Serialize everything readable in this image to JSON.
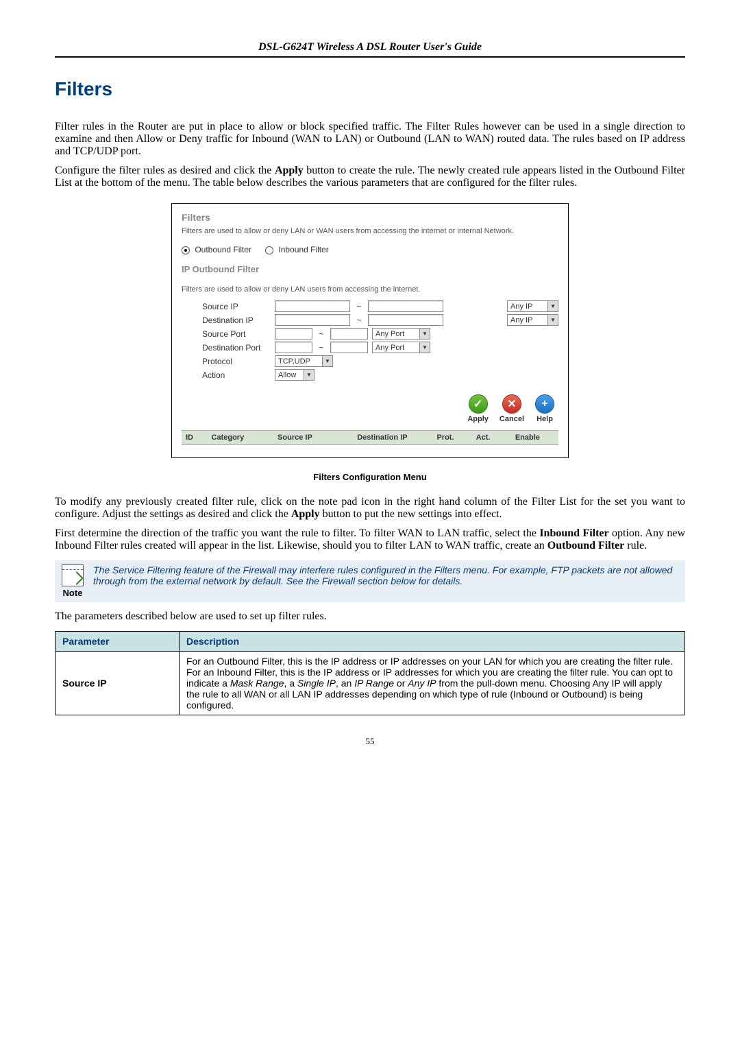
{
  "header": {
    "title": "DSL-G624T Wireless A DSL Router User's Guide"
  },
  "section": {
    "title": "Filters"
  },
  "body": {
    "p1": "Filter rules in the Router are put in place to allow or block specified traffic. The Filter Rules however can be used in a single direction to examine and then Allow or Deny traffic for Inbound (WAN to LAN) or Outbound (LAN to WAN) routed data. The rules based on IP address and TCP/UDP port.",
    "p2a": "Configure the filter rules as desired and click the ",
    "p2_apply": "Apply",
    "p2b": " button to create the rule. The newly created rule appears listed in the Outbound Filter List at the bottom of the menu. The table below describes the various parameters that are configured for the filter rules.",
    "p3a": "To modify any previously created filter rule, click on the note pad icon in the right hand column of the Filter List for the set you want to configure.  Adjust the settings as desired and click the ",
    "p3_apply": "Apply",
    "p3b": " button to put the new settings into effect.",
    "p4a": "First determine the direction of the traffic you want the rule to filter. To filter WAN to LAN traffic, select the ",
    "p4_inbound": "Inbound Filter",
    "p4b": " option. Any new Inbound Filter rules created will appear in the list. Likewise, should you to filter LAN to WAN traffic, create an ",
    "p4_outbound": "Outbound Filter",
    "p4c": " rule.",
    "p5": "The parameters described below are used to set up filter rules."
  },
  "screenshot": {
    "title": "Filters",
    "desc": "Filters are used to allow or deny LAN or WAN users from accessing the internet or internal Network.",
    "radio_outbound": "Outbound Filter",
    "radio_inbound": "Inbound Filter",
    "section": "IP Outbound Filter",
    "sub": "Filters are used to allow or deny LAN users from accessing the internet.",
    "rows": {
      "source_ip": "Source IP",
      "dest_ip": "Destination IP",
      "source_port": "Source Port",
      "dest_port": "Destination Port",
      "protocol": "Protocol",
      "action": "Action"
    },
    "dropdowns": {
      "any_ip": "Any IP",
      "any_port": "Any Port",
      "protocol": "TCP,UDP",
      "action": "Allow"
    },
    "tilde": "~",
    "actions": {
      "apply": "Apply",
      "cancel": "Cancel",
      "help": "Help"
    },
    "list_headers": [
      "ID",
      "Category",
      "Source IP",
      "Destination IP",
      "Prot.",
      "Act.",
      "Enable"
    ]
  },
  "figure_caption": "Filters Configuration Menu",
  "note": {
    "label": "Note",
    "text": "The Service Filtering feature of the Firewall may interfere rules configured in the Filters menu. For example, FTP packets are not allowed through from the external network by default. See the Firewall section below for details."
  },
  "param_table": {
    "headers": {
      "param": "Parameter",
      "desc": "Description"
    },
    "rows": [
      {
        "name": "Source IP",
        "desc_parts": [
          "For an Outbound Filter, this is the IP address or IP addresses on your LAN for which you are creating the filter rule. For an Inbound Filter, this is the IP address or IP addresses for which you are creating the filter rule. You can opt to indicate a ",
          "Mask Range",
          ", a ",
          "Single IP",
          ", an ",
          "IP Range",
          " or ",
          "Any IP",
          " from the pull-down menu. Choosing Any IP will apply the rule to all WAN or all LAN IP addresses depending on which type of rule (Inbound or Outbound) is being configured."
        ]
      }
    ]
  },
  "page_number": "55",
  "icons": {
    "check": "✓",
    "cross": "✕",
    "plus": "+"
  }
}
